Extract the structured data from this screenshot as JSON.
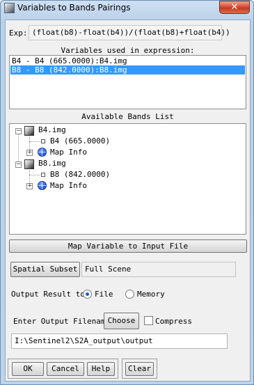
{
  "window": {
    "title": "Variables to Bands Pairings",
    "close_symbol": "✕"
  },
  "expression": {
    "label": "Exp:",
    "value": "(float(b8)-float(b4))/(float(b8)+float(b4))"
  },
  "variables": {
    "header": "Variables used in expression:",
    "items": [
      {
        "text": "B4 - B4 (665.0000):B4.img",
        "selected": false
      },
      {
        "text": "B8 - B8 (842.0000):B8.img",
        "selected": true
      }
    ]
  },
  "bands": {
    "header": "Available Bands List",
    "files": [
      {
        "name": "B4.img",
        "band": "B4 (665.0000)",
        "map_info": "Map Info"
      },
      {
        "name": "B8.img",
        "band": "B8 (842.0000)",
        "map_info": "Map Info"
      }
    ],
    "map_button": "Map Variable to Input File"
  },
  "subset": {
    "button": "Spatial Subset",
    "value": "Full Scene"
  },
  "output": {
    "label": "Output Result to",
    "options": [
      {
        "label": "File",
        "checked": true
      },
      {
        "label": "Memory",
        "checked": false
      }
    ],
    "filename_label": "Enter Output Filename",
    "choose_button": "Choose",
    "compress_label": "Compress",
    "compress_checked": false,
    "filename_value": "I:\\Sentinel2\\S2A_output\\output"
  },
  "buttons": {
    "ok": "OK",
    "cancel": "Cancel",
    "help": "Help",
    "clear": "Clear"
  },
  "colors": {
    "selection": "#3399ff",
    "radio_dot": "#1d5fc4",
    "title_close": "#c23a1f"
  }
}
